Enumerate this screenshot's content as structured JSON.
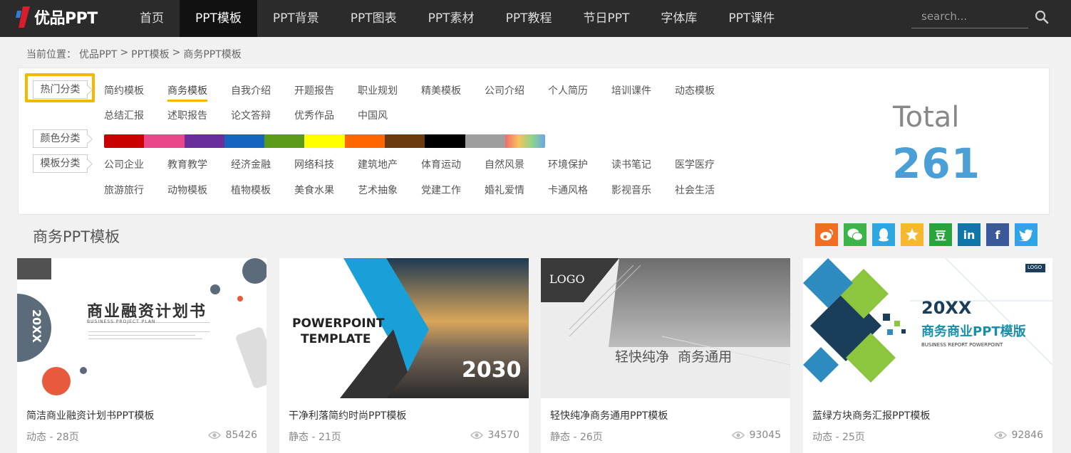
{
  "brand": {
    "name": "优品PPT"
  },
  "nav": {
    "items": [
      "首页",
      "PPT模板",
      "PPT背景",
      "PPT图表",
      "PPT素材",
      "PPT教程",
      "节日PPT",
      "字体库",
      "PPT课件"
    ],
    "active": "PPT模板"
  },
  "search": {
    "placeholder": "search..."
  },
  "breadcrumb": {
    "prefix": "当前位置：",
    "items": [
      "优品PPT",
      "PPT模板",
      "商务PPT模板"
    ],
    "separator": ">"
  },
  "filters": {
    "hot_label": "热门分类",
    "hot_items": [
      "简约模板",
      "商务模板",
      "自我介绍",
      "开题报告",
      "职业规划",
      "精美模板",
      "公司介绍",
      "个人简历",
      "培训课件",
      "动态模板",
      "总结汇报",
      "述职报告",
      "论文答辩",
      "优秀作品",
      "中国风"
    ],
    "hot_active": "商务模板",
    "color_label": "颜色分类",
    "colors": [
      "#c80000",
      "#e8488a",
      "#6a2d9c",
      "#1565c0",
      "#5b9a18",
      "#ffff00",
      "#ff6600",
      "#6b3a0f",
      "#000000",
      "#9e9e9e",
      "rainbow"
    ],
    "type_label": "模板分类",
    "type_items": [
      "公司企业",
      "教育教学",
      "经济金融",
      "网络科技",
      "建筑地产",
      "体育运动",
      "自然风景",
      "环境保护",
      "读书笔记",
      "医学医疗",
      "旅游旅行",
      "动物模板",
      "植物模板",
      "美食水果",
      "艺术抽象",
      "党建工作",
      "婚礼爱情",
      "卡通风格",
      "影视音乐",
      "社会生活"
    ]
  },
  "total": {
    "label": "Total",
    "value": "261"
  },
  "section": {
    "title": "商务PPT模板"
  },
  "share": [
    {
      "icon": "weibo-icon",
      "color": "#f26d21"
    },
    {
      "icon": "wechat-icon",
      "color": "#3bb54a"
    },
    {
      "icon": "qq-icon",
      "color": "#2ea7e0"
    },
    {
      "icon": "qzone-icon",
      "color": "#f5b82e"
    },
    {
      "icon": "douban-icon",
      "color": "#2aa33c",
      "text": "豆"
    },
    {
      "icon": "linkedin-icon",
      "color": "#0e76a8",
      "text": "in"
    },
    {
      "icon": "facebook-icon",
      "color": "#3b5998",
      "text": "f"
    },
    {
      "icon": "twitter-icon",
      "color": "#2fa4e7"
    }
  ],
  "cards": [
    {
      "title": "简洁商业融资计划书PPT模板",
      "type": "动态",
      "pages": "28页",
      "views": "85426",
      "thumb": {
        "heading": "商业融资计划书",
        "sub": "BUSINESS PROJECT PLAN",
        "badge": "20XX"
      }
    },
    {
      "title": "干净利落简约时尚PPT模板",
      "type": "静态",
      "pages": "21页",
      "views": "34570",
      "thumb": {
        "line1": "POWERPOINT",
        "line2": "TEMPLATE",
        "year": "2030"
      }
    },
    {
      "title": "轻快纯净商务通用PPT模板",
      "type": "静态",
      "pages": "26页",
      "views": "93045",
      "thumb": {
        "logo": "LOGO",
        "heading": "轻快纯净  商务通用"
      }
    },
    {
      "title": "蓝绿方块商务汇报PPT模板",
      "type": "动态",
      "pages": "25页",
      "views": "92846",
      "thumb": {
        "year": "20XX",
        "heading": "商务商业PPT模版",
        "sub": "BUSINESS REPORT POWERPOINT",
        "logo": "LOGO"
      }
    }
  ]
}
